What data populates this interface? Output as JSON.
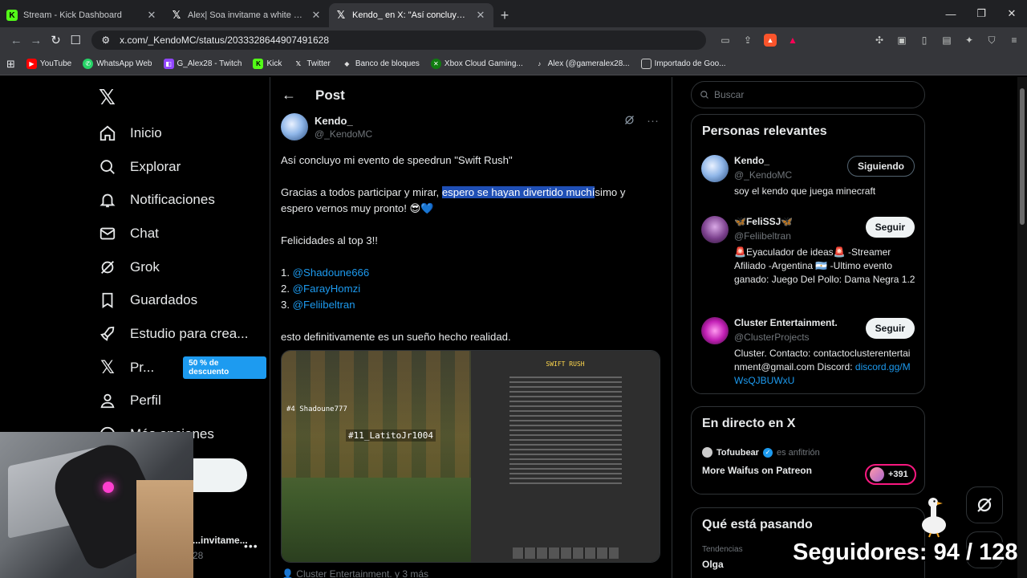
{
  "browser": {
    "tabs": [
      {
        "label": "Stream - Kick Dashboard",
        "favicon": "kick-icon",
        "active": false
      },
      {
        "label": "Alex| Soa invitame a white Rooms Ve",
        "favicon": "x-icon",
        "active": false
      },
      {
        "label": "Kendo_ en X: \"Así concluyo mi e",
        "favicon": "x-icon",
        "active": true
      }
    ],
    "url": "x.com/_KendoMC/status/2033328644907491628",
    "bookmarks": [
      {
        "label": "YouTube",
        "color": "#ff0000"
      },
      {
        "label": "WhatsApp Web",
        "color": "#25d366"
      },
      {
        "label": "G_Alex28 - Twitch",
        "color": "#9146ff"
      },
      {
        "label": "Kick",
        "color": "#53fc18"
      },
      {
        "label": "Twitter",
        "color": "#ffffff"
      },
      {
        "label": "Banco de bloques",
        "color": "#cccccc"
      },
      {
        "label": "Xbox Cloud Gaming...",
        "color": "#107c10"
      },
      {
        "label": "Alex (@gameralex28...",
        "color": "#ffffff"
      },
      {
        "label": "Importado de Goo...",
        "color": "#cccccc"
      }
    ]
  },
  "sidebar": {
    "items": [
      {
        "label": "Inicio",
        "icon": "home-icon"
      },
      {
        "label": "Explorar",
        "icon": "search-icon"
      },
      {
        "label": "Notificaciones",
        "icon": "bell-icon"
      },
      {
        "label": "Chat",
        "icon": "mail-icon"
      },
      {
        "label": "Grok",
        "icon": "grok-icon"
      },
      {
        "label": "Guardados",
        "icon": "bookmark-icon"
      },
      {
        "label": "Estudio para crea...",
        "icon": "rocket-icon"
      },
      {
        "label": "Pr...",
        "icon": "x-icon"
      },
      {
        "label": "Perfil",
        "icon": "person-icon"
      },
      {
        "label": "Más opciones",
        "icon": "more-icon"
      }
    ],
    "premium_badge": "50 % de descuento",
    "account": {
      "name": "...invitame...",
      "handle": "28"
    }
  },
  "post": {
    "header": "Post",
    "author_name": "Kendo_",
    "author_handle": "@_KendoMC",
    "line1": "Así concluyo mi evento de speedrun \"Swift Rush\"",
    "line2_pre": "Gracias a todos participar y mirar, ",
    "line2_highlight": "espero se hayan divertido muchí",
    "line2_post": "simo y espero vernos muy pronto! 😎💙",
    "line3": "Felicidades al top 3!!",
    "top": [
      {
        "rank": "1.",
        "handle": "@Shadoune666"
      },
      {
        "rank": "2.",
        "handle": "@FarayHomzi"
      },
      {
        "rank": "3.",
        "handle": "@Feliibeltran"
      }
    ],
    "line4": "esto definitivamente es un sueño hecho realidad.",
    "media_left_tag": "#11_LatitoJr1004",
    "media_left_tag2": "#4 Shadoune777",
    "media_board_title": "SWIFT RUSH",
    "reply_hint": "Cluster Entertainment. y 3 más"
  },
  "right": {
    "search_placeholder": "Buscar",
    "relevant_title": "Personas relevantes",
    "people": [
      {
        "name": "Kendo_",
        "handle": "@_KendoMC",
        "bio": "soy el kendo que juega minecraft",
        "button": "Siguiendo"
      },
      {
        "name": "🦋FeliSSJ🦋",
        "handle": "@Feliibeltran",
        "bio": "🚨Eyaculador de ideas🚨 -Streamer Afiliado -Argentina 🇦🇷 -Ultimo evento ganado: Juego Del Pollo: Dama Negra 1.2",
        "button": "Seguir"
      },
      {
        "name": "Cluster Entertainment.",
        "handle": "@ClusterProjects",
        "bio": "Cluster. Contacto: contactoclusterentertainment@gmail.com Discord: ",
        "bio_link": "discord.gg/MWsQJBUWxU",
        "button": "Seguir"
      }
    ],
    "live_title": "En directo en X",
    "live_host": "Tofuubear",
    "live_role": "es anfitrión",
    "live_name": "More Waifus on Patreon",
    "live_count": "+391",
    "trends_title": "Qué está pasando",
    "trend_category": "Tendencias",
    "trend_name": "Olga"
  },
  "overlay": {
    "followers": "Seguidores: 94 / 128"
  }
}
